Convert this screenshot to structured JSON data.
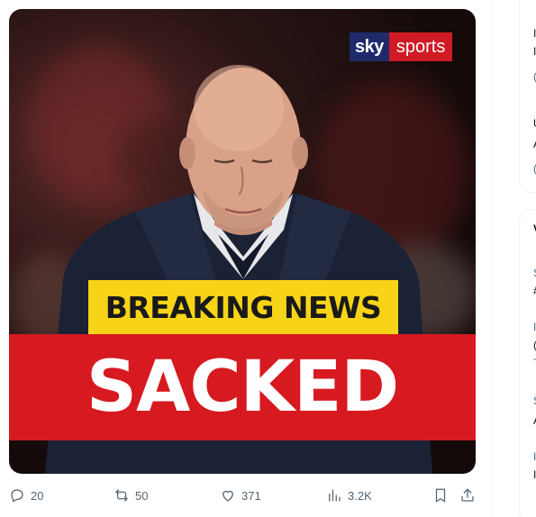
{
  "media": {
    "logo": {
      "sky": "sky",
      "sports": "sports"
    },
    "banner_top": "BREAKING NEWS",
    "banner_main": "SACKED"
  },
  "actions": {
    "reply_count": "20",
    "retweet_count": "50",
    "like_count": "371",
    "views_count": "3.2K"
  },
  "sidebar": {
    "fragments": [
      "I",
      "I",
      "(",
      "U",
      "A",
      "(",
      "V",
      "S",
      "#",
      "I",
      "(",
      "T",
      "S",
      "A",
      "I",
      "I"
    ]
  },
  "colors": {
    "yellow": "#f7d417",
    "red": "#d71920",
    "sky_blue": "#1f2a6b",
    "sports_red": "#d01b24",
    "icon_gray": "#536471"
  }
}
